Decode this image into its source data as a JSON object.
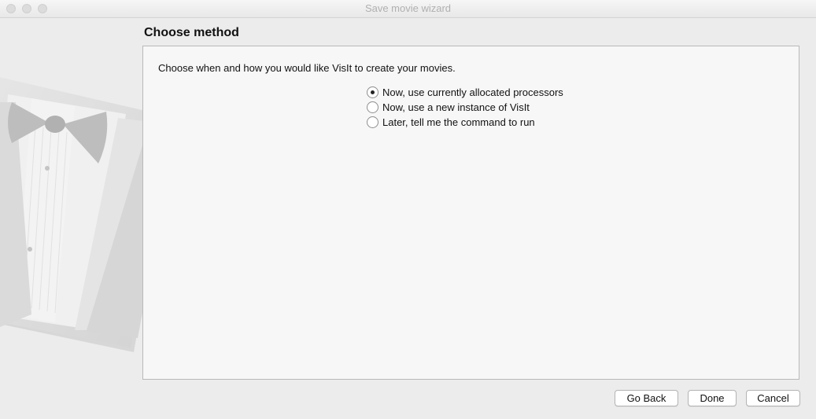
{
  "window": {
    "title": "Save movie wizard"
  },
  "page": {
    "heading": "Choose method",
    "prompt": "Choose when and how you would like VisIt to create your movies.",
    "options": [
      {
        "label": "Now, use currently allocated processors",
        "selected": true
      },
      {
        "label": "Now, use a new instance of VisIt",
        "selected": false
      },
      {
        "label": "Later, tell me the command to run",
        "selected": false
      }
    ]
  },
  "buttons": {
    "back": "Go Back",
    "done": "Done",
    "cancel": "Cancel"
  }
}
